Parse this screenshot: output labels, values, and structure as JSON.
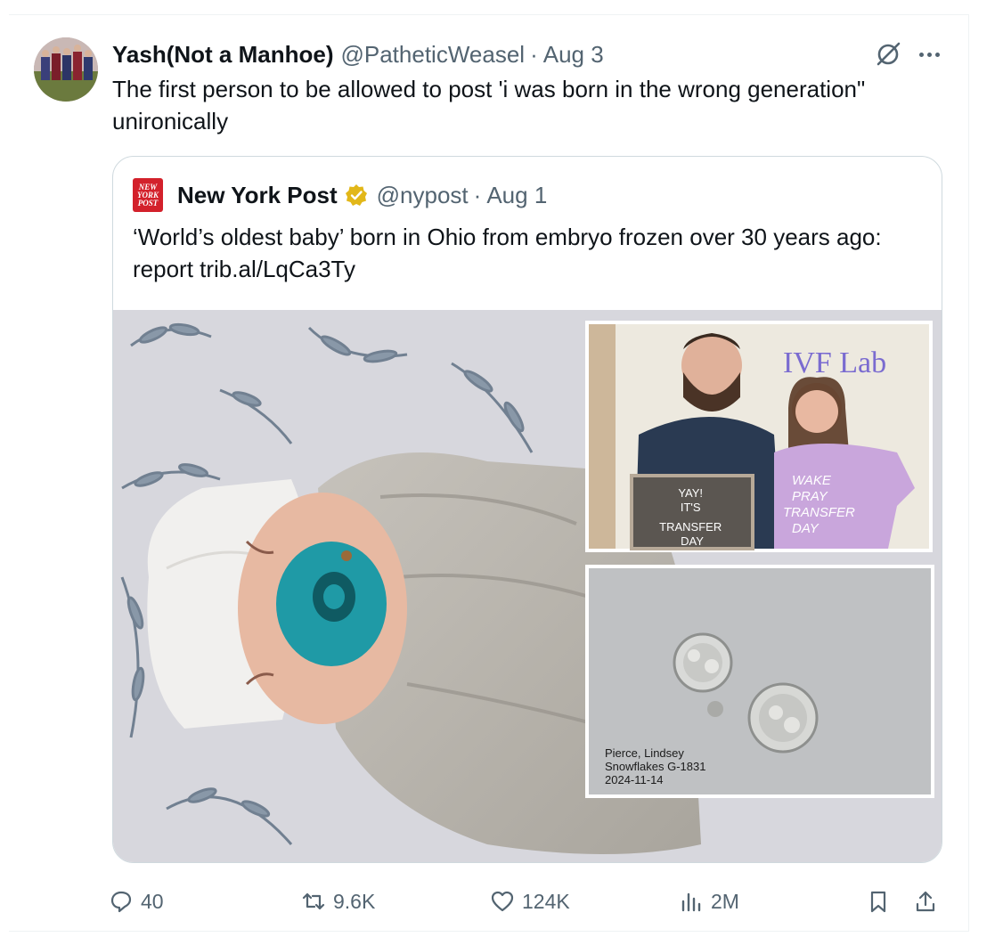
{
  "tweet": {
    "author_name": "Yash(Not a Manhoe)",
    "handle": "@PatheticWeasel",
    "separator": "·",
    "date": "Aug 3",
    "text": "The first person to be allowed to post 'i was born in the wrong generation\" unironically"
  },
  "quote": {
    "logo_lines": [
      "NEW",
      "YORK",
      "POST"
    ],
    "author_name": "New York Post",
    "verified": true,
    "handle": "@nypost",
    "separator": "·",
    "date": "Aug 1",
    "text": "‘World’s oldest baby’ born in Ohio from embryo frozen over 30 years ago: report trib.al/LqCa3Ty",
    "image": {
      "sign_lines": [
        "YAY!",
        "IT'S",
        "TRANSFER",
        "DAY"
      ],
      "wall_text": "IVF Lab",
      "shirt_lines": [
        "WAKE",
        "PRAY",
        "TRANSFER",
        "DAY"
      ],
      "micro_label_lines": [
        "Pierce, Lindsey",
        "Snowflakes G-1831",
        "2024-11-14"
      ]
    }
  },
  "actions": {
    "replies": "40",
    "reposts": "9.6K",
    "likes": "124K",
    "views": "2M"
  },
  "colors": {
    "text": "#0f1419",
    "muted": "#536471",
    "border": "#cfd9de",
    "nypost_red": "#d3212b",
    "gold_badge": "#e2b719"
  }
}
